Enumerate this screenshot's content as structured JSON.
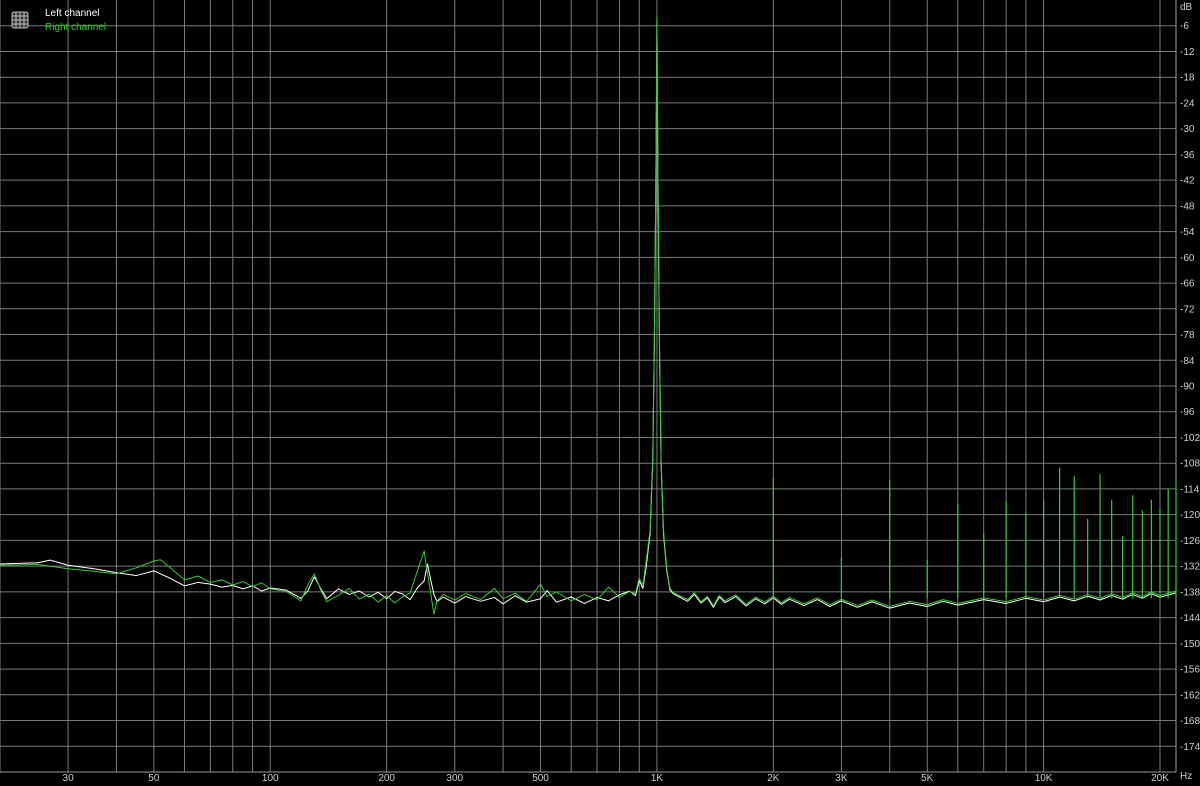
{
  "chart_data": {
    "type": "line",
    "x_scale": "log",
    "xlim": [
      20,
      22000
    ],
    "ylim": [
      -180,
      0
    ],
    "xlabel": "Hz",
    "ylabel": "dB",
    "grid": true,
    "legend_placement": "top-left",
    "x_tick_values": [
      30,
      50,
      100,
      200,
      300,
      500,
      1000,
      2000,
      3000,
      5000,
      10000,
      20000
    ],
    "x_tick_labels": [
      "30",
      "50",
      "100",
      "200",
      "300",
      "500",
      "1K",
      "2K",
      "3K",
      "5K",
      "10K",
      "20K"
    ],
    "y_tick_values": [
      -6,
      -12,
      -18,
      -24,
      -30,
      -36,
      -42,
      -48,
      -54,
      -60,
      -66,
      -72,
      -78,
      -84,
      -90,
      -96,
      -102,
      -108,
      -114,
      -120,
      -126,
      -132,
      -138,
      -144,
      -150,
      -156,
      -162,
      -168,
      -174
    ],
    "y_tick_labels": [
      "-6",
      "-12",
      "-18",
      "-24",
      "-30",
      "-36",
      "-42",
      "-48",
      "-54",
      "-60",
      "-66",
      "-72",
      "-78",
      "-84",
      "-90",
      "-96",
      "-102",
      "-108",
      "-114",
      "-120",
      "-126",
      "-132",
      "-138",
      "-144",
      "-150",
      "-156",
      "-162",
      "-168",
      "-174"
    ],
    "series": [
      {
        "name": "Left channel",
        "color": "#ffffff",
        "points": [
          [
            20,
            -131.5
          ],
          [
            25,
            -131.2
          ],
          [
            27,
            -130.6
          ],
          [
            30,
            -131.8
          ],
          [
            35,
            -132.6
          ],
          [
            40,
            -133.5
          ],
          [
            45,
            -134.2
          ],
          [
            50,
            -133.1
          ],
          [
            55,
            -134.8
          ],
          [
            60,
            -136.6
          ],
          [
            65,
            -135.8
          ],
          [
            70,
            -136.2
          ],
          [
            75,
            -136.9
          ],
          [
            80,
            -136.5
          ],
          [
            85,
            -137.3
          ],
          [
            90,
            -136.6
          ],
          [
            95,
            -137.8
          ],
          [
            100,
            -137.1
          ],
          [
            110,
            -137.6
          ],
          [
            120,
            -139.5
          ],
          [
            125,
            -137.8
          ],
          [
            130,
            -134.5
          ],
          [
            135,
            -137.2
          ],
          [
            140,
            -139.6
          ],
          [
            150,
            -137.3
          ],
          [
            160,
            -138.6
          ],
          [
            170,
            -137.8
          ],
          [
            180,
            -139.2
          ],
          [
            190,
            -138.1
          ],
          [
            200,
            -139.6
          ],
          [
            210,
            -137.9
          ],
          [
            220,
            -138.5
          ],
          [
            230,
            -139.8
          ],
          [
            240,
            -137.1
          ],
          [
            250,
            -135.4
          ],
          [
            255,
            -131.5
          ],
          [
            260,
            -135.2
          ],
          [
            265,
            -138.6
          ],
          [
            270,
            -140.3
          ],
          [
            280,
            -139.2
          ],
          [
            300,
            -140.6
          ],
          [
            320,
            -139.1
          ],
          [
            350,
            -140.2
          ],
          [
            380,
            -139.3
          ],
          [
            400,
            -140.8
          ],
          [
            430,
            -138.9
          ],
          [
            460,
            -140.4
          ],
          [
            500,
            -139.6
          ],
          [
            520,
            -137.7
          ],
          [
            550,
            -140.4
          ],
          [
            600,
            -139.2
          ],
          [
            650,
            -140.7
          ],
          [
            700,
            -139.3
          ],
          [
            750,
            -140.1
          ],
          [
            800,
            -138.7
          ],
          [
            850,
            -137.8
          ],
          [
            880,
            -138.9
          ],
          [
            900,
            -135.4
          ],
          [
            920,
            -137.2
          ],
          [
            940,
            -131.5
          ],
          [
            960,
            -124.5
          ],
          [
            975,
            -108
          ],
          [
            985,
            -80
          ],
          [
            993,
            -45
          ],
          [
            998,
            -18
          ],
          [
            1000,
            -5
          ],
          [
            1002,
            -18
          ],
          [
            1007,
            -45
          ],
          [
            1015,
            -80
          ],
          [
            1025,
            -108
          ],
          [
            1040,
            -124.5
          ],
          [
            1060,
            -133
          ],
          [
            1080,
            -137.5
          ],
          [
            1100,
            -138.4
          ],
          [
            1150,
            -139.3
          ],
          [
            1200,
            -140.2
          ],
          [
            1250,
            -138.6
          ],
          [
            1300,
            -140.6
          ],
          [
            1350,
            -139.4
          ],
          [
            1400,
            -141.6
          ],
          [
            1450,
            -139.2
          ],
          [
            1500,
            -140.5
          ],
          [
            1600,
            -139.1
          ],
          [
            1700,
            -141.3
          ],
          [
            1800,
            -139.6
          ],
          [
            1900,
            -140.8
          ],
          [
            2000,
            -139.4
          ],
          [
            2100,
            -140.9
          ],
          [
            2200,
            -139.7
          ],
          [
            2400,
            -141.2
          ],
          [
            2600,
            -139.8
          ],
          [
            2800,
            -141.4
          ],
          [
            3000,
            -140.1
          ],
          [
            3300,
            -141.6
          ],
          [
            3600,
            -140.3
          ],
          [
            4000,
            -141.8
          ],
          [
            4500,
            -140.6
          ],
          [
            5000,
            -141.4
          ],
          [
            5500,
            -140.2
          ],
          [
            6000,
            -141.1
          ],
          [
            7000,
            -139.8
          ],
          [
            8000,
            -140.7
          ],
          [
            9000,
            -139.5
          ],
          [
            10000,
            -140.3
          ],
          [
            11000,
            -139.2
          ],
          [
            12000,
            -140.1
          ],
          [
            13000,
            -139.0
          ],
          [
            14000,
            -139.9
          ],
          [
            15000,
            -138.8
          ],
          [
            16000,
            -139.7
          ],
          [
            17000,
            -138.6
          ],
          [
            18000,
            -139.5
          ],
          [
            19000,
            -138.4
          ],
          [
            20000,
            -139.3
          ],
          [
            21000,
            -138.7
          ],
          [
            22000,
            -138.2
          ]
        ]
      },
      {
        "name": "Right channel",
        "color": "#33cc33",
        "points": [
          [
            20,
            -131.8
          ],
          [
            25,
            -131.6
          ],
          [
            30,
            -132.6
          ],
          [
            35,
            -133.2
          ],
          [
            40,
            -133.8
          ],
          [
            45,
            -132.4
          ],
          [
            50,
            -130.8
          ],
          [
            52,
            -130.5
          ],
          [
            55,
            -132.3
          ],
          [
            60,
            -135.2
          ],
          [
            65,
            -134.3
          ],
          [
            70,
            -135.8
          ],
          [
            75,
            -135.2
          ],
          [
            80,
            -136.4
          ],
          [
            85,
            -135.6
          ],
          [
            90,
            -136.8
          ],
          [
            95,
            -135.9
          ],
          [
            100,
            -137.3
          ],
          [
            110,
            -137.9
          ],
          [
            120,
            -140.1
          ],
          [
            125,
            -136.4
          ],
          [
            130,
            -133.8
          ],
          [
            135,
            -137.5
          ],
          [
            140,
            -140.3
          ],
          [
            150,
            -138.8
          ],
          [
            160,
            -137.2
          ],
          [
            170,
            -139.7
          ],
          [
            180,
            -138.5
          ],
          [
            190,
            -140.4
          ],
          [
            200,
            -138.9
          ],
          [
            210,
            -140.6
          ],
          [
            220,
            -139.1
          ],
          [
            230,
            -138.3
          ],
          [
            240,
            -133.2
          ],
          [
            250,
            -128.5
          ],
          [
            255,
            -133.6
          ],
          [
            260,
            -138.4
          ],
          [
            265,
            -143.2
          ],
          [
            270,
            -140.1
          ],
          [
            280,
            -138.6
          ],
          [
            300,
            -139.9
          ],
          [
            320,
            -138.4
          ],
          [
            350,
            -139.8
          ],
          [
            380,
            -137.2
          ],
          [
            400,
            -139.6
          ],
          [
            430,
            -138.3
          ],
          [
            460,
            -140.2
          ],
          [
            500,
            -136.2
          ],
          [
            520,
            -139.1
          ],
          [
            550,
            -138.0
          ],
          [
            600,
            -140.1
          ],
          [
            650,
            -138.6
          ],
          [
            700,
            -139.9
          ],
          [
            750,
            -136.9
          ],
          [
            800,
            -139.3
          ],
          [
            850,
            -137.9
          ],
          [
            880,
            -138.4
          ],
          [
            900,
            -134.8
          ],
          [
            920,
            -136.4
          ],
          [
            940,
            -130.2
          ],
          [
            960,
            -123.6
          ],
          [
            975,
            -107
          ],
          [
            985,
            -79
          ],
          [
            993,
            -44
          ],
          [
            998,
            -17
          ],
          [
            1000,
            -4
          ],
          [
            1002,
            -17
          ],
          [
            1007,
            -44
          ],
          [
            1015,
            -79
          ],
          [
            1025,
            -107
          ],
          [
            1040,
            -123.6
          ],
          [
            1060,
            -132.5
          ],
          [
            1080,
            -137.1
          ],
          [
            1100,
            -138.1
          ],
          [
            1150,
            -139.0
          ],
          [
            1200,
            -139.8
          ],
          [
            1250,
            -138.2
          ],
          [
            1300,
            -140.3
          ],
          [
            1350,
            -139.0
          ],
          [
            1400,
            -141.2
          ],
          [
            1450,
            -138.8
          ],
          [
            1500,
            -140.1
          ],
          [
            1600,
            -138.7
          ],
          [
            1700,
            -140.9
          ],
          [
            1800,
            -139.2
          ],
          [
            1900,
            -140.4
          ],
          [
            2000,
            -139.0
          ],
          [
            2100,
            -140.5
          ],
          [
            2200,
            -139.3
          ],
          [
            2400,
            -140.8
          ],
          [
            2600,
            -139.4
          ],
          [
            2800,
            -141.0
          ],
          [
            3000,
            -139.7
          ],
          [
            3300,
            -141.2
          ],
          [
            3600,
            -139.9
          ],
          [
            4000,
            -141.4
          ],
          [
            4500,
            -140.2
          ],
          [
            5000,
            -141.0
          ],
          [
            5500,
            -139.8
          ],
          [
            6000,
            -140.7
          ],
          [
            7000,
            -139.4
          ],
          [
            8000,
            -140.3
          ],
          [
            9000,
            -139.1
          ],
          [
            10000,
            -139.9
          ],
          [
            11000,
            -138.8
          ],
          [
            12000,
            -139.7
          ],
          [
            13000,
            -138.6
          ],
          [
            14000,
            -139.5
          ],
          [
            15000,
            -138.4
          ],
          [
            16000,
            -139.3
          ],
          [
            17000,
            -138.2
          ],
          [
            18000,
            -139.1
          ],
          [
            19000,
            -138.0
          ],
          [
            20000,
            -138.9
          ],
          [
            21000,
            -138.3
          ],
          [
            22000,
            -137.8
          ]
        ]
      }
    ],
    "harmonic_spurs": [
      {
        "freq": 2000,
        "level": -111.5
      },
      {
        "freq": 3000,
        "level": -130.0
      },
      {
        "freq": 4000,
        "level": -112.0
      },
      {
        "freq": 5000,
        "level": -130.5
      },
      {
        "freq": 6000,
        "level": -117.5
      },
      {
        "freq": 7000,
        "level": -124.5
      },
      {
        "freq": 8000,
        "level": -117.0
      },
      {
        "freq": 9000,
        "level": -119.5
      },
      {
        "freq": 10000,
        "level": -116.5
      },
      {
        "freq": 11000,
        "level": -109.0
      },
      {
        "freq": 12000,
        "level": -111.0
      },
      {
        "freq": 13000,
        "level": -121.0
      },
      {
        "freq": 14000,
        "level": -110.5
      },
      {
        "freq": 15000,
        "level": -116.5
      },
      {
        "freq": 16000,
        "level": -125.0
      },
      {
        "freq": 17000,
        "level": -115.5
      },
      {
        "freq": 18000,
        "level": -119.0
      },
      {
        "freq": 19000,
        "level": -116.5
      },
      {
        "freq": 20000,
        "level": -118.5
      },
      {
        "freq": 21000,
        "level": -114.0
      },
      {
        "freq": 22000,
        "level": -111.5
      }
    ]
  }
}
